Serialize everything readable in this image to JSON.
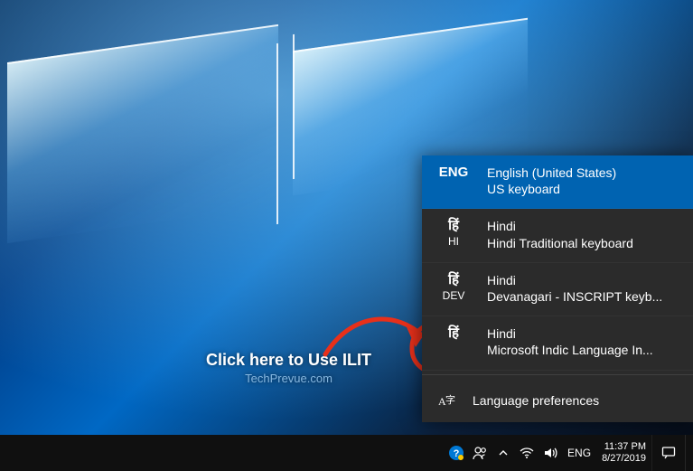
{
  "annotation": {
    "main": "Click here to Use ILIT",
    "sub": "TechPrevue.com"
  },
  "flyout": {
    "items": [
      {
        "code_big": "ENG",
        "code_small": "",
        "name": "English (United States)",
        "keyboard": "US keyboard",
        "selected": true
      },
      {
        "code_big": "हिं",
        "code_small": "HI",
        "name": "Hindi",
        "keyboard": "Hindi Traditional keyboard",
        "selected": false
      },
      {
        "code_big": "हिं",
        "code_small": "DEV",
        "name": "Hindi",
        "keyboard": "Devanagari - INSCRIPT keyb...",
        "selected": false
      },
      {
        "code_big": "हिं",
        "code_small": "",
        "name": "Hindi",
        "keyboard": "Microsoft Indic Language In...",
        "selected": false
      }
    ],
    "preferences_label": "Language preferences"
  },
  "taskbar": {
    "lang_indicator": "ENG",
    "time": "11:37 PM",
    "date": "8/27/2019"
  }
}
